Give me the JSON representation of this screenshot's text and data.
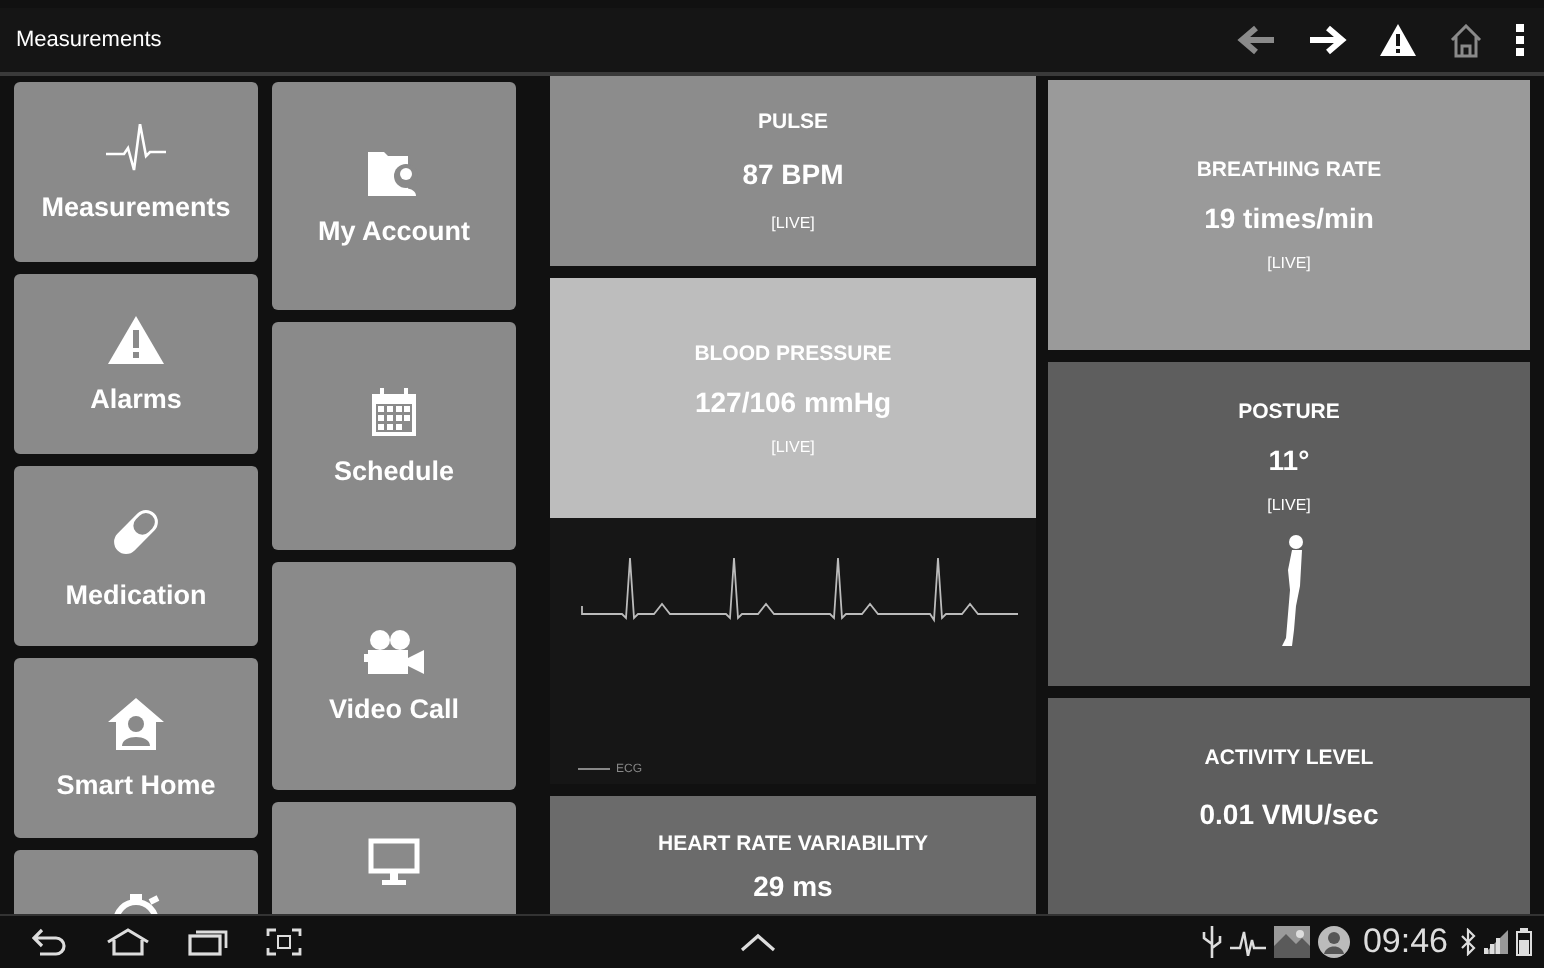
{
  "action_bar": {
    "title": "Measurements",
    "actions": [
      {
        "kind": "back",
        "disabled": true
      },
      {
        "kind": "forward",
        "disabled": false
      },
      {
        "kind": "alarm",
        "disabled": false
      },
      {
        "kind": "home",
        "disabled": true
      },
      {
        "kind": "overflow",
        "disabled": false
      }
    ]
  },
  "menu_columns": [
    [
      {
        "kind": "labelled",
        "label": "Measurements"
      },
      {
        "kind": "labelled",
        "label": "Alarms"
      },
      {
        "kind": "labelled",
        "label": "Medication"
      },
      {
        "kind": "labelled",
        "label": "Smart Home"
      },
      {
        "kind": "cut"
      }
    ],
    [
      {
        "kind": "labelled",
        "label": "My Account"
      },
      {
        "kind": "labelled",
        "label": "Schedule"
      },
      {
        "kind": "labelled",
        "label": "Video Call"
      },
      {
        "kind": "cut"
      }
    ]
  ],
  "tile_columns": [
    [
      {
        "kind": "metric",
        "title": "PULSE",
        "value": "87 BPM",
        "status": "[LIVE]",
        "color": "#8c8c8c"
      },
      {
        "kind": "metric",
        "title": "BLOOD PRESSURE",
        "value": "127/106 mmHg",
        "status": "[LIVE]",
        "color": "#bdbdbd"
      },
      {
        "kind": "ecg",
        "legend": "ECG",
        "color": "#161616"
      },
      {
        "kind": "metric",
        "title": "HEART RATE VARIABILITY",
        "value": "29 ms",
        "color": "#6b6b6b"
      }
    ],
    [
      {
        "kind": "metric",
        "title": "BREATHING RATE",
        "value": "19 times/min",
        "status": "[LIVE]",
        "color": "#9a9a9a"
      },
      {
        "kind": "posture",
        "title": "POSTURE",
        "value": "11°",
        "status": "[LIVE]",
        "color": "#5e5e5e"
      },
      {
        "kind": "metric",
        "title": "ACTIVITY LEVEL",
        "value": "0.01 VMU/sec",
        "color": "#5e5e5e"
      }
    ]
  ],
  "nav_bar": {
    "time": "09:46"
  }
}
